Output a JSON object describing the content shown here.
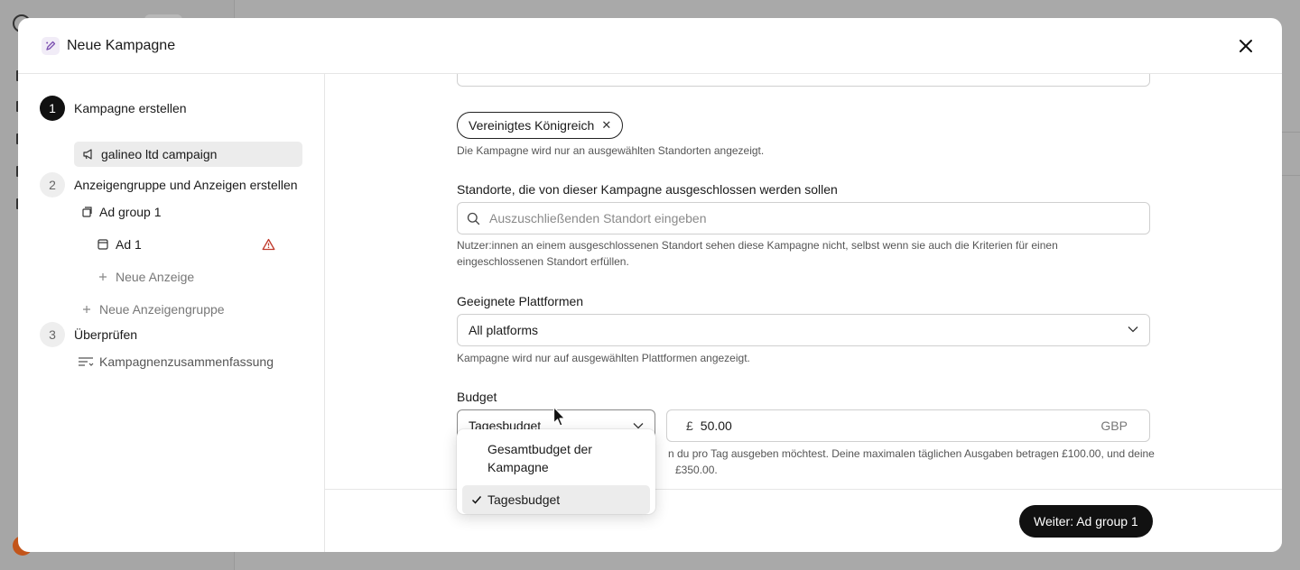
{
  "modal": {
    "title": "Neue Kampagne",
    "close_icon": "close-icon"
  },
  "stepper": {
    "step1": {
      "number": "1",
      "label": "Kampagne erstellen"
    },
    "campaign_item": "galineo ltd campaign",
    "step2": {
      "number": "2",
      "label": "Anzeigengruppe und Anzeigen erstellen"
    },
    "ad_group": "Ad group 1",
    "ad": "Ad 1",
    "new_ad": "Neue Anzeige",
    "new_ad_group": "Neue Anzeigengruppe",
    "step3": {
      "number": "3",
      "label": "Überprüfen"
    },
    "summary": "Kampagnenzusammenfassung"
  },
  "form": {
    "included_location_chip": "Vereinigtes Königreich",
    "included_help": "Die Kampagne wird nur an ausgewählten Standorten angezeigt.",
    "excluded_label": "Standorte, die von dieser Kampagne ausgeschlossen werden sollen",
    "excluded_placeholder": "Auszuschließenden Standort eingeben",
    "excluded_help_line1": "Nutzer:innen an einem ausgeschlossenen Standort sehen diese Kampagne nicht, selbst wenn sie auch die Kriterien für einen",
    "excluded_help_line2": "eingeschlossenen Standort erfüllen.",
    "platforms_label": "Geeignete Plattformen",
    "platforms_value": "All platforms",
    "platforms_help": "Kampagne wird nur auf ausgewählten Plattformen angezeigt.",
    "budget_label": "Budget",
    "budget_type": "Tagesbudget",
    "currency_symbol": "£",
    "budget_amount": "50.00",
    "currency_code": "GBP",
    "budget_help_line1": "n du pro Tag ausgeben möchtest. Deine maximalen täglichen Ausgaben betragen £100.00, und deine",
    "budget_help_line2": "£350.00."
  },
  "dropdown": {
    "options": [
      "Gesamtbudget der Kampagne",
      "Tagesbudget"
    ],
    "selected": "Tagesbudget"
  },
  "footer": {
    "next_label": "Weiter: Ad group 1"
  },
  "colors": {
    "primary": "#111111",
    "warning": "#c0392b",
    "accent_icon": "#7b4fb0"
  }
}
